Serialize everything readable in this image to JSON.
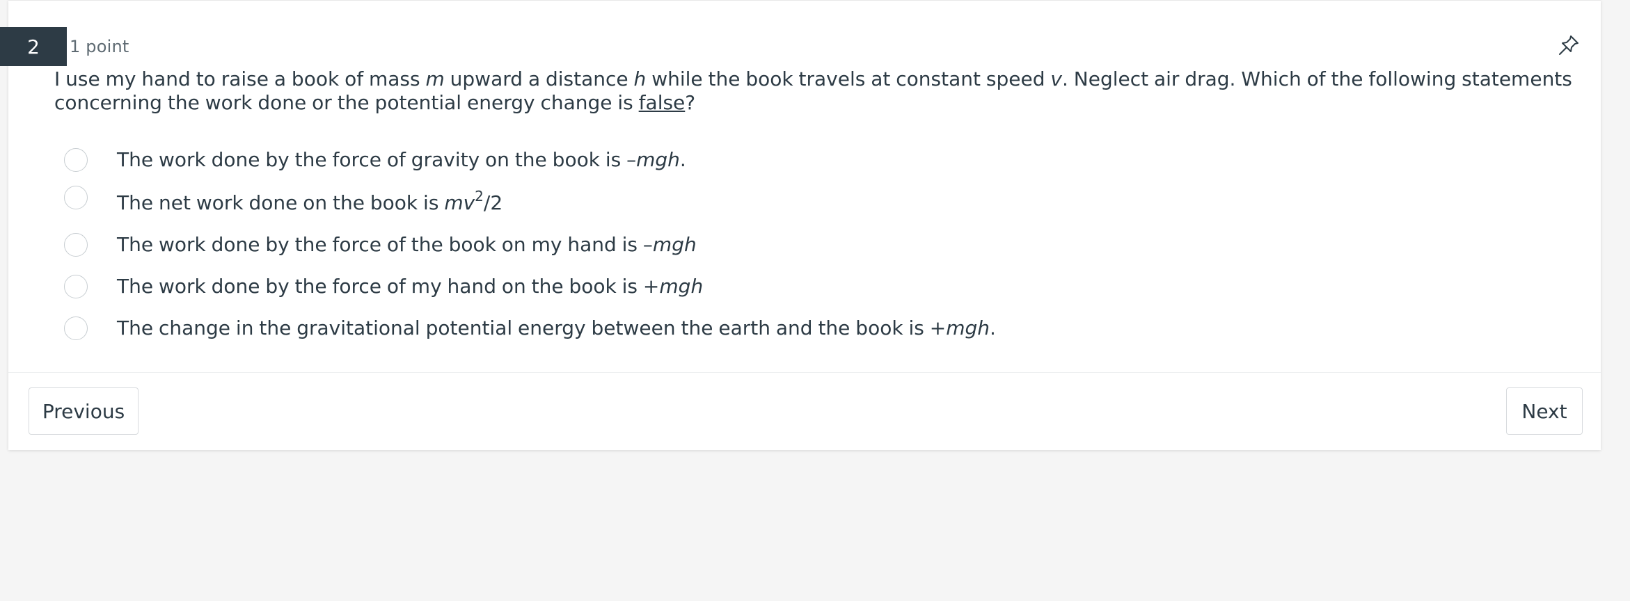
{
  "question": {
    "number": "2",
    "points": "1 point",
    "text_parts": {
      "p1": "I use my hand to raise a book of mass ",
      "m": "m",
      "p2": " upward a distance ",
      "h": "h",
      "p3": " while the book travels at constant speed ",
      "v": "v",
      "p4": ".  Neglect air drag.  Which of the following statements concerning the work done or the potential energy change is ",
      "false_word": "false",
      "p5": "?"
    }
  },
  "answers": [
    {
      "pre": "The work done by the force of gravity on the book is –",
      "em": "mgh",
      "post": "."
    },
    {
      "pre": "The net work done on the book is ",
      "em": "mv",
      "sup": "2",
      "post": "/2"
    },
    {
      "pre": "The work done by the force of the book on my hand is –",
      "em": "mgh",
      "post": ""
    },
    {
      "pre": "The work done by the force of my hand on the book is +",
      "em": "mgh",
      "post": ""
    },
    {
      "pre": " The change in the gravitational potential energy between the earth and the book is +",
      "em": "mgh",
      "post": "."
    }
  ],
  "nav": {
    "previous_label": "Previous",
    "next_label": "Next"
  },
  "icons": {
    "pin": "pin-icon"
  },
  "colors": {
    "question_badge": "#2d3b45",
    "text": "#2d3b45",
    "muted": "#5f6b73",
    "background": "#f5f5f5"
  }
}
